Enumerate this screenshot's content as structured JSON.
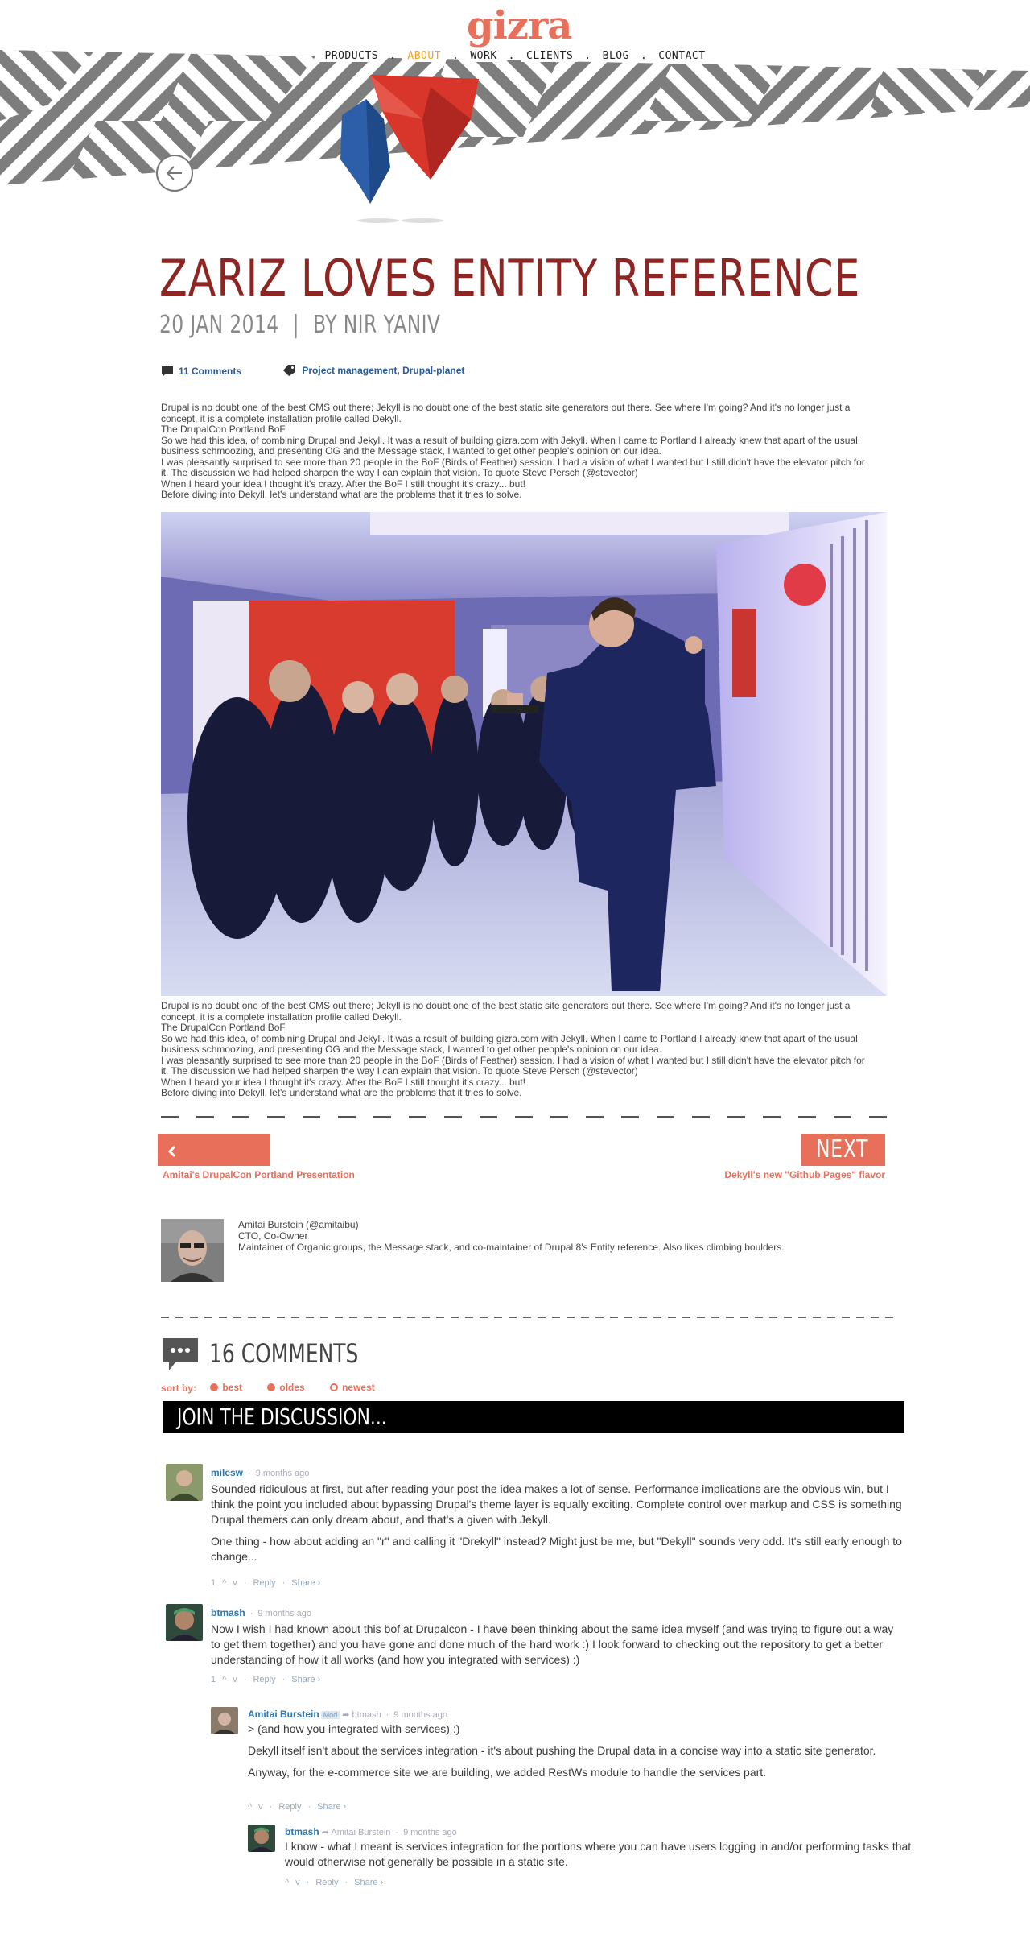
{
  "brand": {
    "logo_text": "gizra",
    "accent": "#e8705a",
    "title_color": "#8d2622",
    "link_color": "#2a79b5"
  },
  "nav": {
    "items": [
      {
        "label": "PRODUCTS",
        "active": false
      },
      {
        "label": "ABOUT",
        "active": true
      },
      {
        "label": "WORK",
        "active": false
      },
      {
        "label": "CLIENTS",
        "active": false
      },
      {
        "label": "BLOG",
        "active": false
      },
      {
        "label": "CONTACT",
        "active": false
      }
    ],
    "separator": "."
  },
  "article": {
    "title": "ZARIZ LOVES ENTITY REFERENCE",
    "date": "20 JAN 2014",
    "divider": "|",
    "byline": "BY NIR YANIV",
    "comments_link": "11 Comments",
    "tags_link": "Project management, Drupal-planet",
    "paragraphs": [
      "Drupal is no doubt one of the best CMS out there; Jekyll is no doubt one of the best static site generators out there. See where I'm going? And it's no longer just a concept, it is a complete installation profile called Dekyll.",
      "The DrupalCon Portland BoF",
      "So we had this idea, of combining Drupal and Jekyll. It was a result of building gizra.com with Jekyll. When I came to Portland I already knew that apart of the usual business schmoozing, and presenting OG and the Message stack, I wanted to get other people's opinion on our idea.",
      "I was pleasantly surprised to see more than 20 people in the BoF (Birds of Feather) session. I had a vision of what I wanted but I still didn't have the elevator pitch for it. The discussion we had helped sharpen the way I can explain that vision. To quote Steve Persch (@stevector)",
      "When I heard your idea I thought it's crazy. After the BoF I still thought it's crazy... but!",
      "Before diving into Dekyll, let's understand what are the problems that it tries to solve."
    ]
  },
  "pager": {
    "prev_label": "PREVIOUS",
    "prev_title": "Amitai's DrupalCon Portland Presentation",
    "next_label": "NEXT",
    "next_title": "Dekyll's new \"Github Pages\" flavor"
  },
  "author": {
    "name": "Amitai Burstein (@amitaibu)",
    "role": "CTO, Co-Owner",
    "bio": "Maintainer of Organic groups, the Message stack, and co-maintainer of Drupal 8's Entity reference. Also likes climbing boulders."
  },
  "comments_section": {
    "count_label": "16 COMMENTS",
    "sort_label": "sort by:",
    "sort_options": [
      "best",
      "oldes",
      "newest"
    ],
    "join_label": "JOIN THE DISCUSSION..."
  },
  "comments": [
    {
      "name": "milesw",
      "time": "9 months ago",
      "paragraphs": [
        "Sounded ridiculous at first, but after reading your post the idea makes a lot of sense. Performance implications are the obvious win, but I think the point you included about bypassing Drupal's theme layer is equally exciting. Complete control over markup and CSS is something Drupal themers can only dream about, and that's a given with Jekyll.",
        "One thing - how about adding an \"r\" and calling it \"Drekyll\" instead? Might just be me, but \"Dekyll\" sounds very odd. It's still early enough to change..."
      ],
      "votes": "1",
      "up": "^",
      "down": "v",
      "reply": "Reply",
      "share": "Share ›"
    },
    {
      "name": "btmash",
      "time": "9 months ago",
      "paragraphs": [
        "Now I wish I had known about this bof at Drupalcon - I have been thinking about the same idea myself (and was trying to figure out a way to get them together) and you have gone and done much of the hard work :) I look forward to checking out the repository to get a better understanding of how it all works (and how you integrated with services) :)"
      ],
      "votes": "1",
      "up": "^",
      "down": "v",
      "reply": "Reply",
      "share": "Share ›"
    },
    {
      "name": "Amitai Burstein",
      "badge": "Mod",
      "reply_to": "btmash",
      "time": "9 months ago",
      "paragraphs": [
        "> (and how you integrated with services) :)",
        "Dekyll itself isn't about the services integration - it's about pushing the Drupal data in a concise way into a static site generator.",
        "Anyway, for the e-commerce site we are building, we added RestWs module to handle the services part."
      ],
      "up": "^",
      "down": "v",
      "reply": "Reply",
      "share": "Share ›"
    },
    {
      "name": "btmash",
      "reply_to": "Amitai Burstein",
      "time": "9 months ago",
      "paragraphs": [
        "I know - what I meant is services integration for the portions where you can have users logging in and/or performing tasks that would otherwise not generally be possible in a static site."
      ],
      "up": "^",
      "down": "v",
      "reply": "Reply",
      "share": "Share ›"
    }
  ]
}
